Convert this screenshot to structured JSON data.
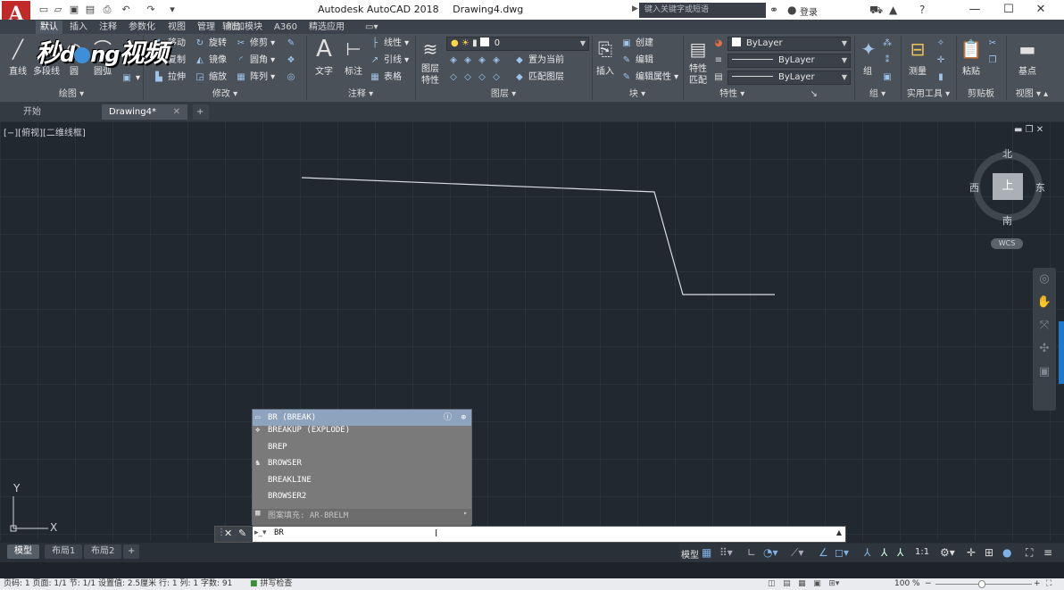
{
  "title_bar": {
    "app_name": "Autodesk AutoCAD 2018",
    "file_name": "Drawing4.dwg",
    "search_placeholder": "键入关键字或短语",
    "login_label": "登录",
    "app_logo_letter": "A"
  },
  "menu_tabs": [
    "默认",
    "插入",
    "注释",
    "参数化",
    "视图",
    "管理",
    "输出",
    "附加模块",
    "A360",
    "精选应用"
  ],
  "ribbon": {
    "draw": {
      "title": "绘图",
      "line": "直线",
      "polyline": "多段线",
      "circle": "圆",
      "arc": "圆弧"
    },
    "modify": {
      "title": "修改",
      "move": "移动",
      "rotate": "旋转",
      "trim": "修剪",
      "copy": "复制",
      "mirror": "镜像",
      "fillet": "圆角",
      "stretch": "拉伸",
      "scale": "缩放",
      "array": "阵列"
    },
    "annotation": {
      "title": "注释",
      "text": "文字",
      "dimension": "标注",
      "linear": "线性",
      "leader": "引线",
      "table": "表格"
    },
    "layers": {
      "title": "图层",
      "layer_properties": "图层特性",
      "current_layer": "0",
      "set_current": "置为当前",
      "match_layer": "匹配图层"
    },
    "block": {
      "title": "块",
      "insert": "插入",
      "create": "创建",
      "edit": "编辑",
      "edit_attributes": "编辑属性"
    },
    "properties": {
      "title": "特性",
      "match_properties": "特性匹配",
      "color": "ByLayer",
      "linetype": "ByLayer",
      "lineweight": "ByLayer"
    },
    "groups": {
      "title": "组",
      "group": "组"
    },
    "utilities": {
      "title": "实用工具",
      "measure": "测量"
    },
    "clipboard": {
      "title": "剪贴板",
      "paste": "粘贴"
    },
    "view": {
      "title": "视图",
      "base": "基点"
    }
  },
  "doc_tabs": [
    "开始",
    "Drawing4*"
  ],
  "canvas": {
    "view_label": "[−][俯视][二维线框]",
    "viewcube": {
      "north": "北",
      "south": "南",
      "east": "东",
      "west": "西",
      "top": "上",
      "wcs": "WCS"
    },
    "ucs": {
      "x": "X",
      "y": "Y"
    }
  },
  "autocomplete": {
    "header": "BR (BREAK)",
    "items": [
      "BREAKUP (EXPLODE)",
      "BREP",
      "BROWSER",
      "BREAKLINE",
      "BROWSER2"
    ],
    "footer": "图案填充: AR-BRELM"
  },
  "command_line": {
    "text": "BR"
  },
  "layout_tabs": [
    "模型",
    "布局1",
    "布局2"
  ],
  "status_bar": {
    "model_label": "模型",
    "scale": "1:1"
  },
  "bottom_bar": {
    "text": "页码: 1  页面: 1/1  节: 1/1  设置值: 2.5厘米  行: 1  列: 1  字数: 91",
    "spell_check": "拼写检查",
    "zoom": "100 %"
  },
  "colors": {
    "canvas_bg": "#212830",
    "ribbon_bg": "#4a5159",
    "logo_red": "#c22a2a",
    "autocomplete_head": "#8ea3bd"
  }
}
